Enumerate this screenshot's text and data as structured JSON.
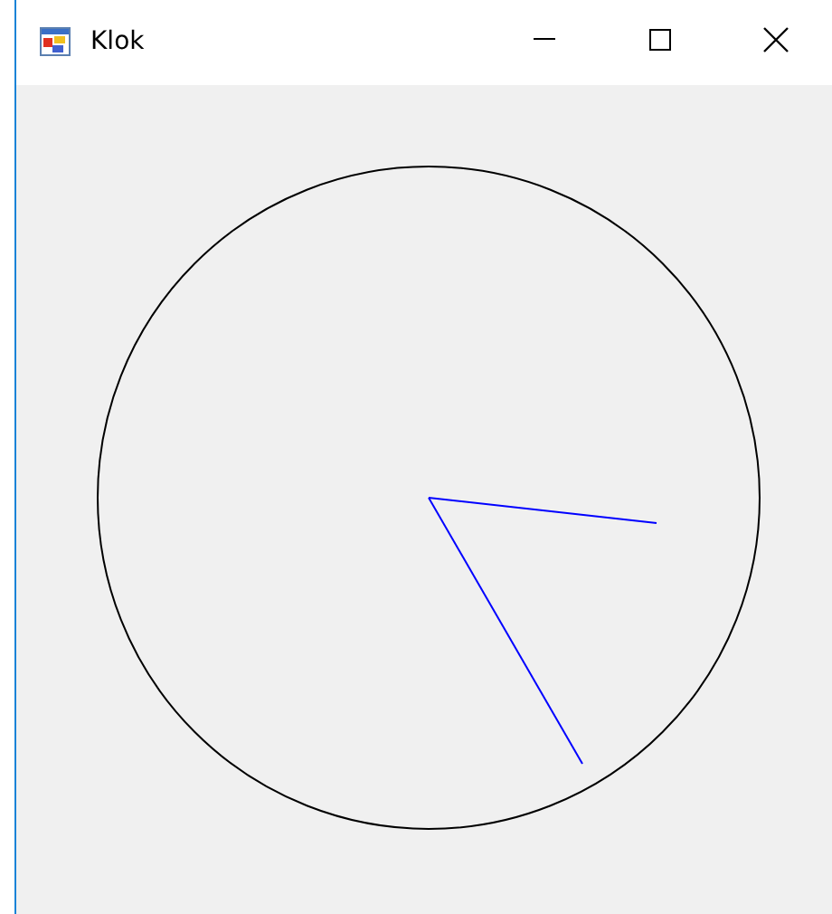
{
  "window": {
    "title": "Klok"
  }
}
